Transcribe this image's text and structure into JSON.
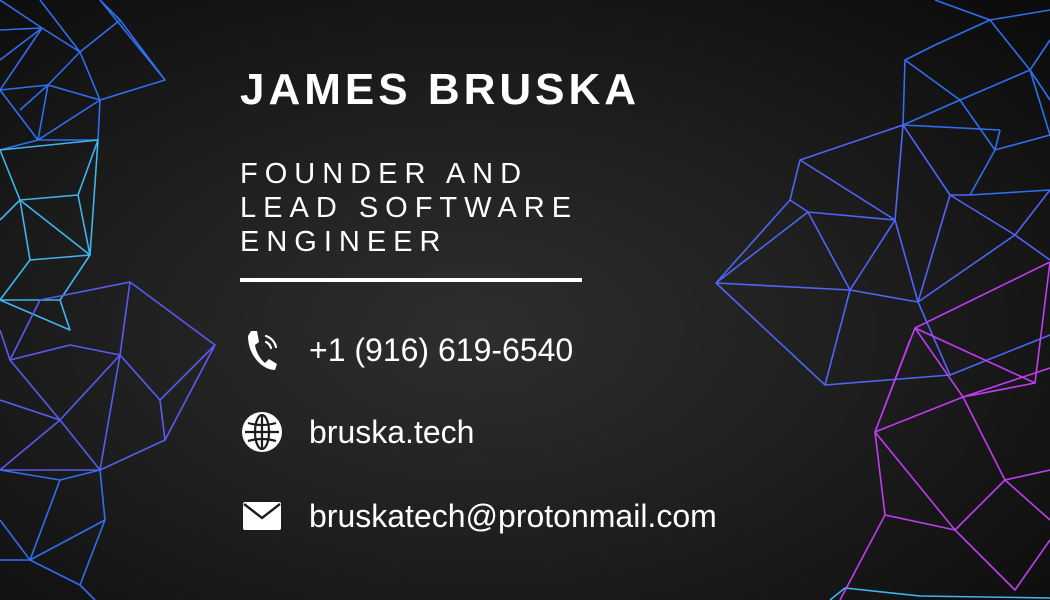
{
  "card": {
    "name": "JAMES BRUSKA",
    "title_lines": [
      "FOUNDER AND",
      "LEAD SOFTWARE",
      "ENGINEER"
    ],
    "contacts": [
      {
        "type": "phone",
        "icon": "phone-icon",
        "text": "+1 (916) 619-6540"
      },
      {
        "type": "website",
        "icon": "globe-icon",
        "text": "bruska.tech"
      },
      {
        "type": "email",
        "icon": "mail-icon",
        "text": "bruskatech@protonmail.com"
      }
    ]
  },
  "colors": {
    "background": "#1f1f1f",
    "text": "#ffffff",
    "network_left": [
      "#2f6ff0",
      "#3fb5f0",
      "#5a5cf0"
    ],
    "network_right": [
      "#2f6ff0",
      "#4f66f5",
      "#c23cf2"
    ]
  }
}
